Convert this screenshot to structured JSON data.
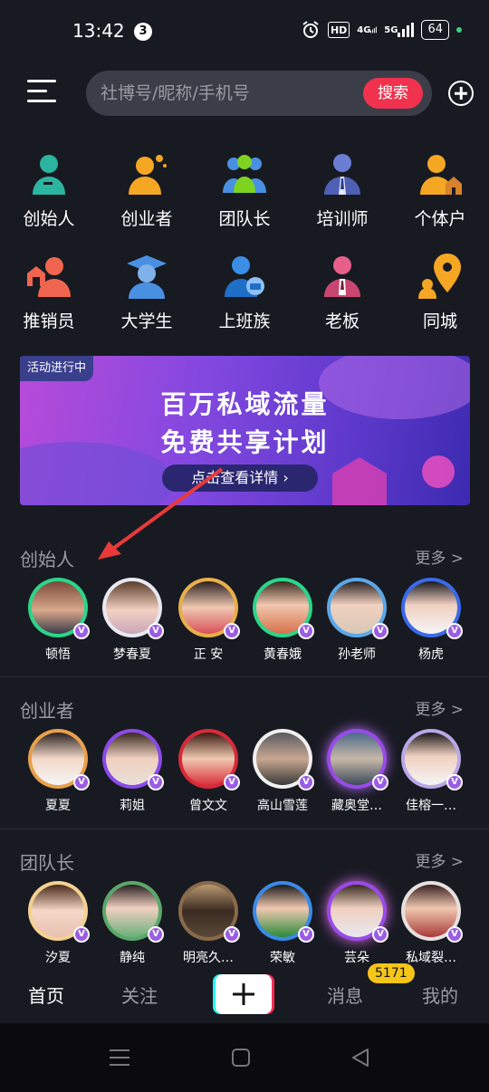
{
  "status": {
    "time": "13:42",
    "notification_count": "3",
    "hd": "HD",
    "net1": "4G",
    "net2": "5G",
    "battery": "64"
  },
  "search": {
    "placeholder": "社博号/昵称/手机号",
    "button": "搜索"
  },
  "categories": [
    {
      "label": "创始人",
      "icon": "founder-icon"
    },
    {
      "label": "创业者",
      "icon": "entrepreneur-icon"
    },
    {
      "label": "团队长",
      "icon": "team-leader-icon"
    },
    {
      "label": "培训师",
      "icon": "trainer-icon"
    },
    {
      "label": "个体户",
      "icon": "self-employed-icon"
    },
    {
      "label": "推销员",
      "icon": "salesman-icon"
    },
    {
      "label": "大学生",
      "icon": "student-icon"
    },
    {
      "label": "上班族",
      "icon": "office-worker-icon"
    },
    {
      "label": "老板",
      "icon": "boss-icon"
    },
    {
      "label": "同城",
      "icon": "location-icon"
    }
  ],
  "banner": {
    "tag": "活动进行中",
    "line1": "百万私域流量",
    "line2": "免费共享计划",
    "button": "点击查看详情 ›"
  },
  "sections": [
    {
      "title": "创始人",
      "more": "更多 >",
      "people": [
        "顿悟",
        "梦春夏",
        "正 安",
        "黄春娥",
        "孙老师",
        "杨虎"
      ]
    },
    {
      "title": "创业者",
      "more": "更多 >",
      "people": [
        "夏夏",
        "莉姐",
        "曾文文",
        "高山雪莲",
        "藏奥堂…",
        "佳榕一…"
      ]
    },
    {
      "title": "团队长",
      "more": "更多 >",
      "people": [
        "汐夏",
        "静纯",
        "明亮久…",
        "荣敏",
        "芸朵",
        "私域裂…"
      ]
    }
  ],
  "nav": {
    "home": "首页",
    "follow": "关注",
    "messages": "消息",
    "message_badge": "5171",
    "me": "我的"
  },
  "colors": {
    "background": "#181a22",
    "accent": "#f0324f",
    "badge": "#f5c518",
    "vip": "#9b5de5"
  }
}
